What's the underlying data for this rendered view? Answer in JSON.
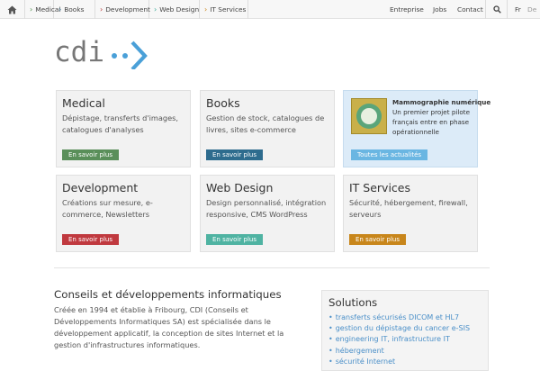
{
  "topnav": {
    "left": [
      {
        "label": "Medical",
        "chevron_color": "#4c8c4a"
      },
      {
        "label": "Books",
        "chevron_color": "#2e6c8e"
      },
      {
        "label": "Development",
        "chevron_color": "#b83a3a"
      },
      {
        "label": "Web Design",
        "chevron_color": "#3aaa96"
      },
      {
        "label": "IT Services",
        "chevron_color": "#c98416"
      }
    ],
    "right": [
      "Entreprise",
      "Jobs",
      "Contact"
    ],
    "lang_fr": "Fr",
    "lang_de": "De"
  },
  "logo": {
    "text": "cdi",
    "accent_color": "#4aa0d8"
  },
  "cards": [
    {
      "title": "Medical",
      "desc": "Dépistage, transferts d'images, catalogues d'analyses",
      "button": "En savoir plus",
      "color": "#5a8f5a"
    },
    {
      "title": "Books",
      "desc": "Gestion de stock, catalogues de livres, sites e-commerce",
      "button": "En savoir plus",
      "color": "#2e6c8e"
    },
    {
      "title": "Development",
      "desc": "Créations sur mesure, e-commerce, Newsletters",
      "button": "En savoir plus",
      "color": "#c0393f"
    },
    {
      "title": "Web Design",
      "desc": "Design personnalisé, intégration responsive, CMS WordPress",
      "button": "En savoir plus",
      "color": "#4fb3a2"
    },
    {
      "title": "IT Services",
      "desc": "Sécurité, hébergement, firewall, serveurs",
      "button": "En savoir plus",
      "color": "#c8861b"
    }
  ],
  "news": {
    "title": "Mammographie numérique",
    "text": "Un premier projet pilote français entre en phase opérationnelle",
    "button": "Toutes les actualités",
    "button_color": "#6ab6e2"
  },
  "about": {
    "heading": "Conseils et développements informatiques",
    "text": "Créée en 1994 et établie à Fribourg, CDI (Conseils et Développements Informatiques SA) est spécialisée dans le développement applicatif, la conception de sites Internet et la gestion d'infrastructures informatiques."
  },
  "solutions": {
    "title": "Solutions",
    "items": [
      "transferts sécurisés DICOM et HL7",
      "gestion du dépistage du cancer e-SIS",
      "engineering IT, infrastructure IT",
      "hébergement",
      "sécurité Internet"
    ]
  }
}
